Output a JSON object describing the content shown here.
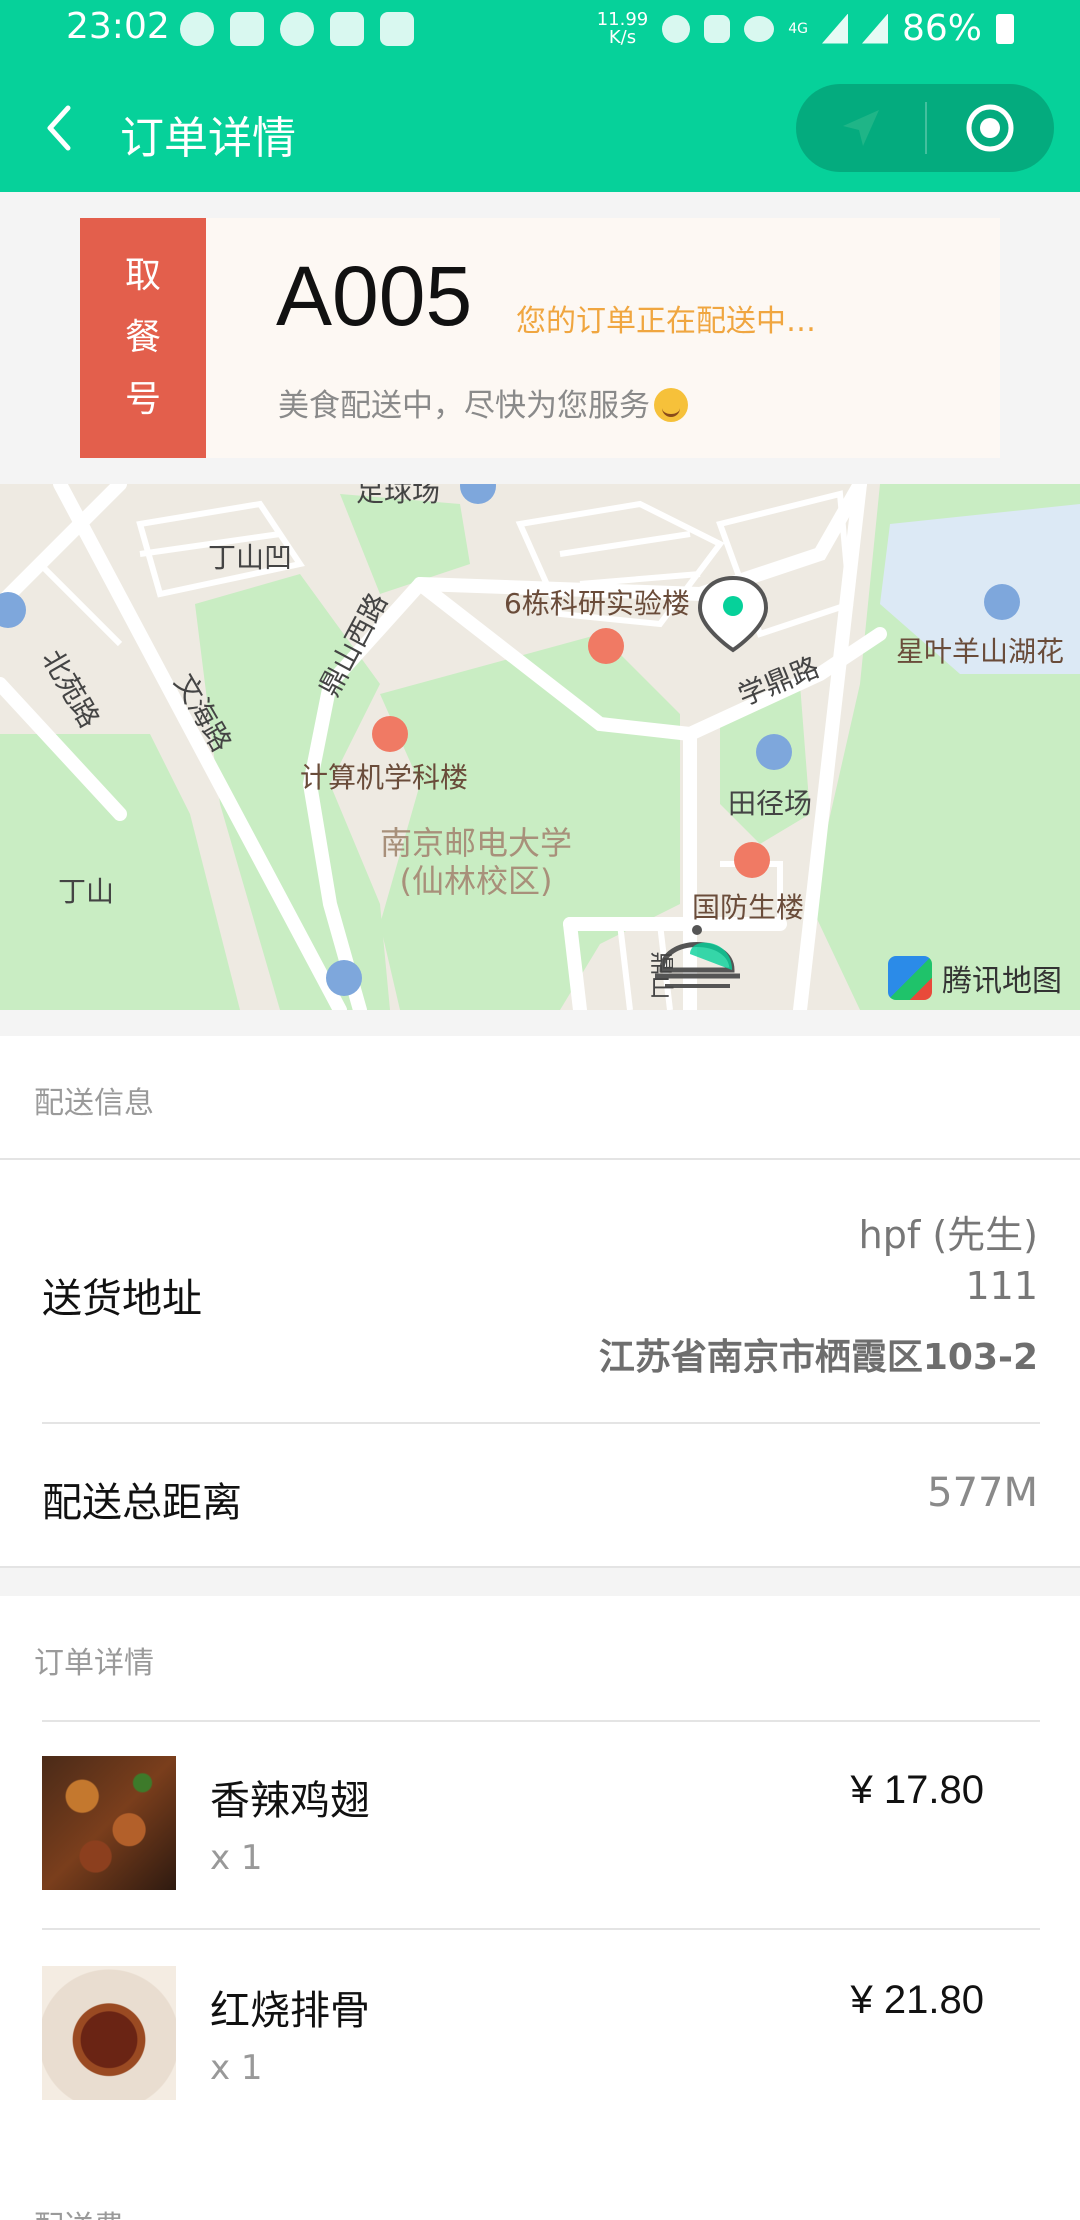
{
  "status_bar": {
    "time": "23:02",
    "net_speed": "11.99\nK/s",
    "network": "4G",
    "battery": "86%"
  },
  "nav": {
    "title": "订单详情",
    "back_icon": "back-chevron-icon",
    "capsule_left_icon": "location-arrow-icon",
    "capsule_right_icon": "target-circle-icon"
  },
  "pickup": {
    "tag_chars": [
      "取",
      "餐",
      "号"
    ],
    "number": "A005",
    "status": "您的订单正在配送中…",
    "message": "美食配送中，尽快为您服务"
  },
  "map": {
    "labels": {
      "stadium_top": "足球场",
      "dingshan_ao": "丁山凹",
      "lab": "6栋科研实验楼",
      "lake": "星叶羊山湖花",
      "beiyuan": "北苑路",
      "wenhai": "文海路",
      "dingxi": "鼎山西路",
      "xueding": "学鼎路",
      "computer": "计算机学科楼",
      "track": "田径场",
      "university_1": "南京邮电大学",
      "university_2": "(仙林校区)",
      "dingshan": "丁山",
      "defense": "国防生楼",
      "road_bottom": "鼎山"
    },
    "brand": "腾讯地图",
    "colors": {
      "green": "#c9edc3",
      "road": "#ffffff",
      "water": "#dce9f5",
      "base": "#eeeae2"
    }
  },
  "delivery_info": {
    "section_title": "配送信息",
    "address_label": "送货地址",
    "recipient": "hpf (先生)",
    "phone": "111",
    "address": "江苏省南京市栖霞区103-2",
    "distance_label": "配送总距离",
    "distance": "577M"
  },
  "order_details": {
    "section_title": "订单详情",
    "items": [
      {
        "name": "香辣鸡翅",
        "qty": "x 1",
        "price": "¥ 17.80"
      },
      {
        "name": "红烧排骨",
        "qty": "x 1",
        "price": "¥ 21.80"
      }
    ],
    "next_section_partial": "配送费"
  },
  "colors": {
    "brand_green": "#06d19a",
    "pickup_red": "#e35f4c",
    "status_orange": "#f0a640"
  }
}
